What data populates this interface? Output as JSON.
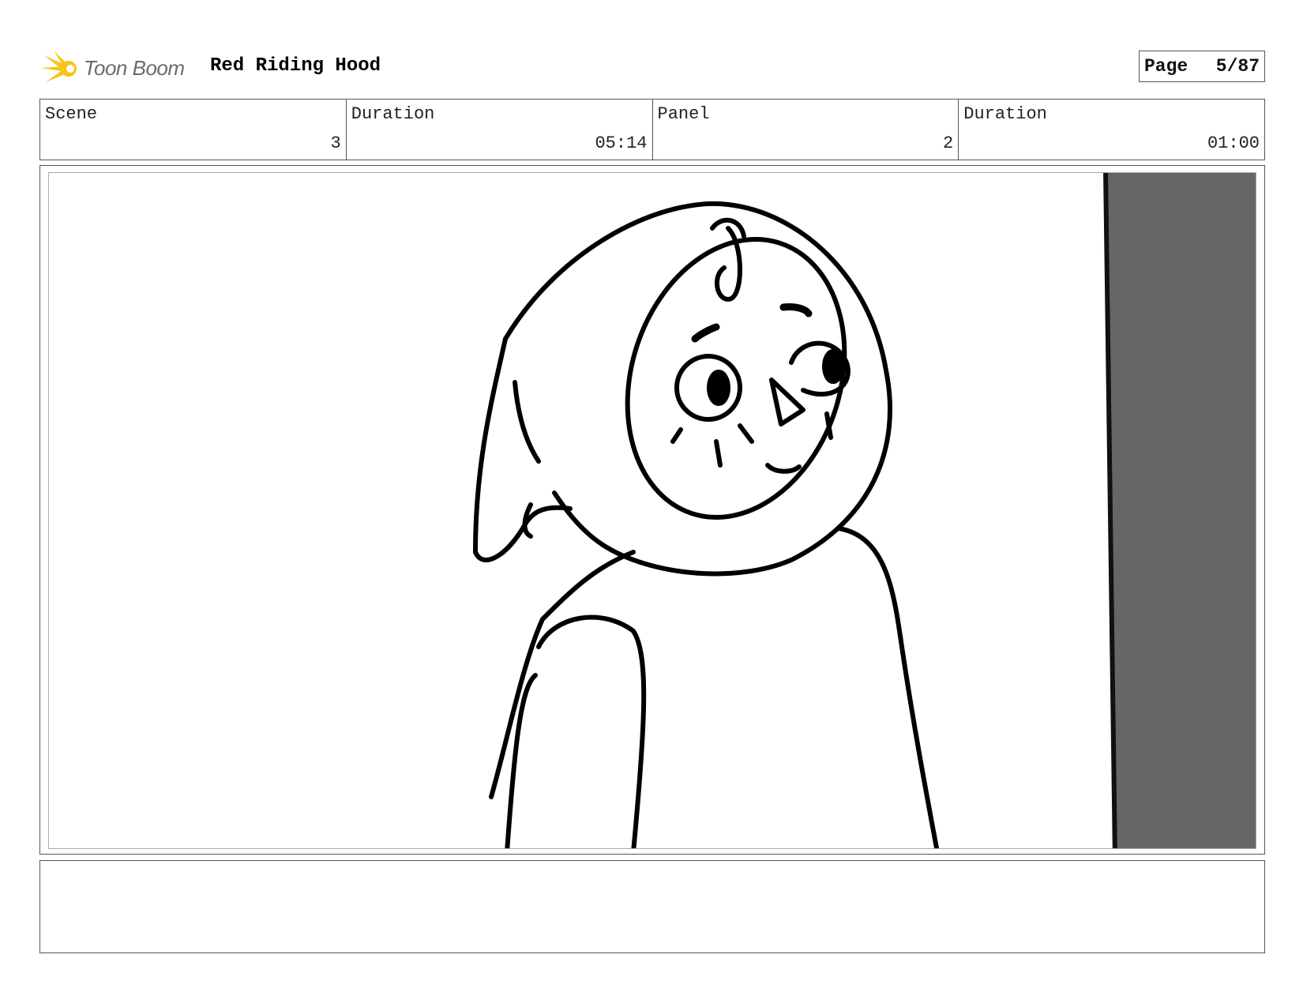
{
  "header": {
    "brand": "Toon Boom",
    "project_title": "Red Riding Hood",
    "page_label": "Page",
    "page_number": "5/87"
  },
  "info": {
    "scene_label": "Scene",
    "scene_value": "3",
    "scene_duration_label": "Duration",
    "scene_duration_value": "05:14",
    "panel_label": "Panel",
    "panel_value": "2",
    "panel_duration_label": "Duration",
    "panel_duration_value": "01:00"
  },
  "caption": {
    "text": ""
  },
  "colors": {
    "brand_yellow": "#f5c518",
    "brand_text": "#6b6b6b",
    "shadow_panel": "#666666"
  },
  "icons": {
    "logo": "toon-boom-star-icon"
  }
}
